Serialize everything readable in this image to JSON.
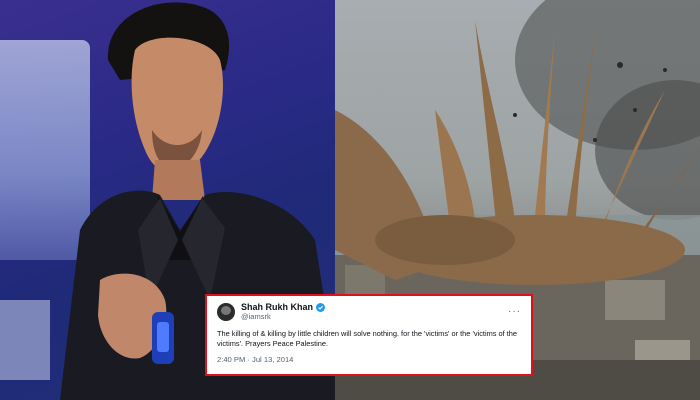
{
  "images": {
    "left": {
      "subject": "man-in-dark-suit-on-stage-photo"
    },
    "right": {
      "subject": "explosion-over-city-photo"
    }
  },
  "tweet": {
    "display_name": "Shah Rukh Khan",
    "verified": true,
    "handle": "@iamsrk",
    "more_icon": "more-horizontal-icon",
    "text": "The killing of & killing by little children will solve nothing. for the 'victims' or the 'victims of the victims'. Prayers Peace Palestine.",
    "timestamp": "2:40 PM · Jul 13, 2014",
    "colors": {
      "border": "#e0101a",
      "verified_badge": "#1d9bf0",
      "text": "#0f1419",
      "muted": "#536471"
    }
  }
}
